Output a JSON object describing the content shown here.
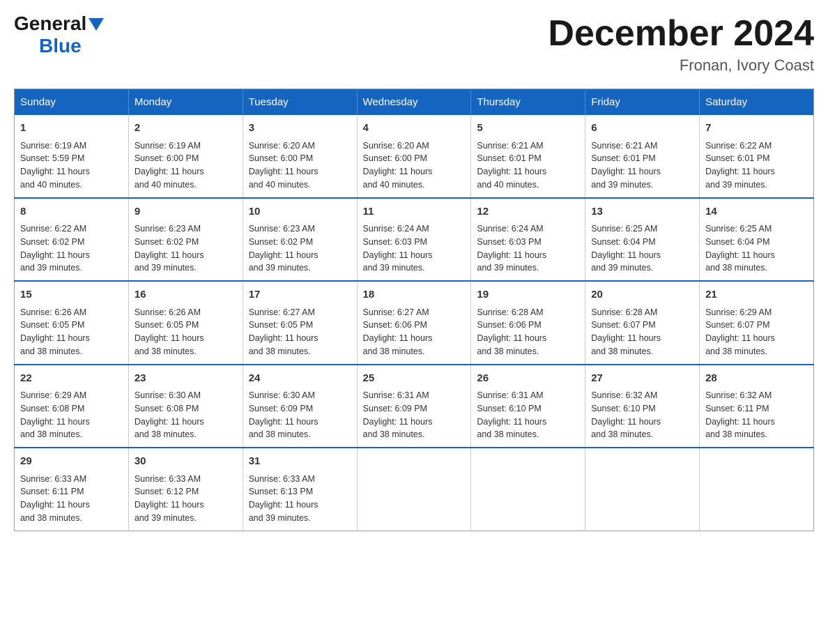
{
  "header": {
    "logo": {
      "general": "General",
      "blue": "Blue",
      "arrow": "▲"
    },
    "title": "December 2024",
    "location": "Fronan, Ivory Coast"
  },
  "calendar": {
    "days_of_week": [
      "Sunday",
      "Monday",
      "Tuesday",
      "Wednesday",
      "Thursday",
      "Friday",
      "Saturday"
    ],
    "weeks": [
      [
        {
          "day": "1",
          "sunrise": "6:19 AM",
          "sunset": "5:59 PM",
          "daylight": "11 hours and 40 minutes."
        },
        {
          "day": "2",
          "sunrise": "6:19 AM",
          "sunset": "6:00 PM",
          "daylight": "11 hours and 40 minutes."
        },
        {
          "day": "3",
          "sunrise": "6:20 AM",
          "sunset": "6:00 PM",
          "daylight": "11 hours and 40 minutes."
        },
        {
          "day": "4",
          "sunrise": "6:20 AM",
          "sunset": "6:00 PM",
          "daylight": "11 hours and 40 minutes."
        },
        {
          "day": "5",
          "sunrise": "6:21 AM",
          "sunset": "6:01 PM",
          "daylight": "11 hours and 40 minutes."
        },
        {
          "day": "6",
          "sunrise": "6:21 AM",
          "sunset": "6:01 PM",
          "daylight": "11 hours and 39 minutes."
        },
        {
          "day": "7",
          "sunrise": "6:22 AM",
          "sunset": "6:01 PM",
          "daylight": "11 hours and 39 minutes."
        }
      ],
      [
        {
          "day": "8",
          "sunrise": "6:22 AM",
          "sunset": "6:02 PM",
          "daylight": "11 hours and 39 minutes."
        },
        {
          "day": "9",
          "sunrise": "6:23 AM",
          "sunset": "6:02 PM",
          "daylight": "11 hours and 39 minutes."
        },
        {
          "day": "10",
          "sunrise": "6:23 AM",
          "sunset": "6:02 PM",
          "daylight": "11 hours and 39 minutes."
        },
        {
          "day": "11",
          "sunrise": "6:24 AM",
          "sunset": "6:03 PM",
          "daylight": "11 hours and 39 minutes."
        },
        {
          "day": "12",
          "sunrise": "6:24 AM",
          "sunset": "6:03 PM",
          "daylight": "11 hours and 39 minutes."
        },
        {
          "day": "13",
          "sunrise": "6:25 AM",
          "sunset": "6:04 PM",
          "daylight": "11 hours and 39 minutes."
        },
        {
          "day": "14",
          "sunrise": "6:25 AM",
          "sunset": "6:04 PM",
          "daylight": "11 hours and 38 minutes."
        }
      ],
      [
        {
          "day": "15",
          "sunrise": "6:26 AM",
          "sunset": "6:05 PM",
          "daylight": "11 hours and 38 minutes."
        },
        {
          "day": "16",
          "sunrise": "6:26 AM",
          "sunset": "6:05 PM",
          "daylight": "11 hours and 38 minutes."
        },
        {
          "day": "17",
          "sunrise": "6:27 AM",
          "sunset": "6:05 PM",
          "daylight": "11 hours and 38 minutes."
        },
        {
          "day": "18",
          "sunrise": "6:27 AM",
          "sunset": "6:06 PM",
          "daylight": "11 hours and 38 minutes."
        },
        {
          "day": "19",
          "sunrise": "6:28 AM",
          "sunset": "6:06 PM",
          "daylight": "11 hours and 38 minutes."
        },
        {
          "day": "20",
          "sunrise": "6:28 AM",
          "sunset": "6:07 PM",
          "daylight": "11 hours and 38 minutes."
        },
        {
          "day": "21",
          "sunrise": "6:29 AM",
          "sunset": "6:07 PM",
          "daylight": "11 hours and 38 minutes."
        }
      ],
      [
        {
          "day": "22",
          "sunrise": "6:29 AM",
          "sunset": "6:08 PM",
          "daylight": "11 hours and 38 minutes."
        },
        {
          "day": "23",
          "sunrise": "6:30 AM",
          "sunset": "6:08 PM",
          "daylight": "11 hours and 38 minutes."
        },
        {
          "day": "24",
          "sunrise": "6:30 AM",
          "sunset": "6:09 PM",
          "daylight": "11 hours and 38 minutes."
        },
        {
          "day": "25",
          "sunrise": "6:31 AM",
          "sunset": "6:09 PM",
          "daylight": "11 hours and 38 minutes."
        },
        {
          "day": "26",
          "sunrise": "6:31 AM",
          "sunset": "6:10 PM",
          "daylight": "11 hours and 38 minutes."
        },
        {
          "day": "27",
          "sunrise": "6:32 AM",
          "sunset": "6:10 PM",
          "daylight": "11 hours and 38 minutes."
        },
        {
          "day": "28",
          "sunrise": "6:32 AM",
          "sunset": "6:11 PM",
          "daylight": "11 hours and 38 minutes."
        }
      ],
      [
        {
          "day": "29",
          "sunrise": "6:33 AM",
          "sunset": "6:11 PM",
          "daylight": "11 hours and 38 minutes."
        },
        {
          "day": "30",
          "sunrise": "6:33 AM",
          "sunset": "6:12 PM",
          "daylight": "11 hours and 39 minutes."
        },
        {
          "day": "31",
          "sunrise": "6:33 AM",
          "sunset": "6:13 PM",
          "daylight": "11 hours and 39 minutes."
        },
        null,
        null,
        null,
        null
      ]
    ],
    "labels": {
      "sunrise": "Sunrise:",
      "sunset": "Sunset:",
      "daylight": "Daylight:"
    }
  }
}
